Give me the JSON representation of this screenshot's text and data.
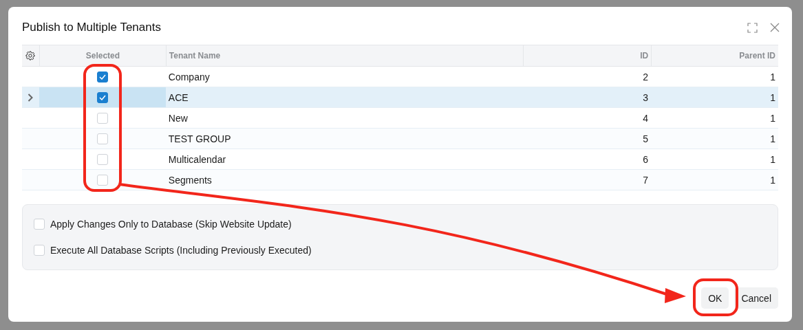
{
  "dialog": {
    "title": "Publish to Multiple Tenants"
  },
  "table": {
    "columns": [
      {
        "label": "Selected"
      },
      {
        "label": "Tenant Name"
      },
      {
        "label": "ID"
      },
      {
        "label": "Parent ID"
      }
    ],
    "rows": [
      {
        "checked": true,
        "name": "Company",
        "id": "2",
        "parent_id": "1",
        "current": false
      },
      {
        "checked": true,
        "name": "ACE",
        "id": "3",
        "parent_id": "1",
        "current": true
      },
      {
        "checked": false,
        "name": "New",
        "id": "4",
        "parent_id": "1",
        "current": false
      },
      {
        "checked": false,
        "name": "TEST GROUP",
        "id": "5",
        "parent_id": "1",
        "current": false
      },
      {
        "checked": false,
        "name": "Multicalendar",
        "id": "6",
        "parent_id": "1",
        "current": false
      },
      {
        "checked": false,
        "name": "Segments",
        "id": "7",
        "parent_id": "1",
        "current": false
      }
    ]
  },
  "options": [
    {
      "label": "Apply Changes Only to Database (Skip Website Update)",
      "checked": false
    },
    {
      "label": "Execute All Database Scripts (Including Previously Executed)",
      "checked": false
    }
  ],
  "buttons": [
    {
      "label": "OK"
    },
    {
      "label": "Cancel"
    }
  ]
}
